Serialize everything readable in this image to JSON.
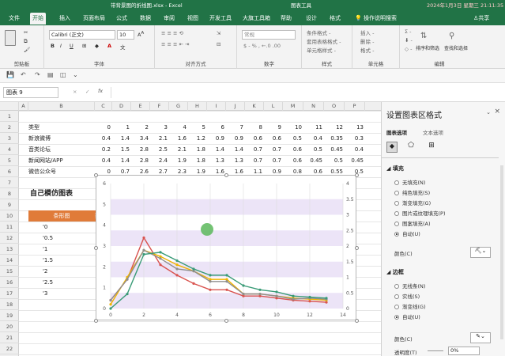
{
  "window": {
    "file_title": "带背景图的折线图.xlsx - Excel",
    "context_tab": "图表工具",
    "date_time": "2024年1月3日 星期三 21:11:35"
  },
  "tabs": [
    {
      "label": "文件"
    },
    {
      "label": "开始"
    },
    {
      "label": "插入"
    },
    {
      "label": "页面布局"
    },
    {
      "label": "公式"
    },
    {
      "label": "数据"
    },
    {
      "label": "审阅"
    },
    {
      "label": "视图"
    },
    {
      "label": "开发工具"
    },
    {
      "label": "大旗工具箱"
    },
    {
      "label": "帮助"
    },
    {
      "label": "设计"
    },
    {
      "label": "格式"
    }
  ],
  "tell_me": "操作说明搜索",
  "share": "共享",
  "ribbon": {
    "clipboard_label": "剪贴板",
    "font_name": "Calibri (正文)",
    "font_size": "10",
    "font_label": "字体",
    "align_label": "对齐方式",
    "number_format": "常规",
    "number_label": "数字",
    "cond_format": "条件格式 -",
    "table_format": "套用表格格式 -",
    "cell_styles": "单元格样式 -",
    "styles_label": "样式",
    "insert": "插入 -",
    "delete": "删除 -",
    "format": "格式 -",
    "cells_label": "单元格",
    "sort_filter": "排序和筛选",
    "find_select": "查找和选择",
    "edit_label": "编辑"
  },
  "formula_bar": {
    "name_box": "图表 9",
    "fx": "fx",
    "cancel": "×",
    "confirm": "✓"
  },
  "columns": [
    "A",
    "B",
    "C",
    "D",
    "E",
    "F",
    "G",
    "H",
    "I",
    "J",
    "K",
    "L",
    "M",
    "N",
    "O",
    "P"
  ],
  "rows": [
    "1",
    "2",
    "3",
    "4",
    "5",
    "6",
    "7",
    "8",
    "9",
    "10",
    "11",
    "12",
    "13",
    "14",
    "15",
    "16",
    "17",
    "18",
    "19",
    "20",
    "21",
    "22"
  ],
  "table": {
    "header_label": "类型",
    "header_values": [
      "0",
      "1",
      "2",
      "3",
      "4",
      "5",
      "6",
      "7",
      "8",
      "9",
      "10",
      "11",
      "12",
      "13"
    ],
    "rows": [
      {
        "label": "新浪微博",
        "values": [
          "0.4",
          "1.4",
          "3.4",
          "2.1",
          "1.6",
          "1.2",
          "0.9",
          "0.9",
          "0.6",
          "0.6",
          "0.5",
          "0.4",
          "0.35",
          "0.3"
        ]
      },
      {
        "label": "音类论坛",
        "values": [
          "0.2",
          "1.5",
          "2.8",
          "2.5",
          "2.1",
          "1.8",
          "1.4",
          "1.4",
          "0.7",
          "0.7",
          "0.6",
          "0.5",
          "0.45",
          "0.4"
        ]
      },
      {
        "label": "新闻网站/APP",
        "values": [
          "0.4",
          "1.4",
          "2.8",
          "2.4",
          "1.9",
          "1.8",
          "1.3",
          "1.3",
          "0.7",
          "0.7",
          "0.6",
          "0.45",
          "0.5",
          "0.45"
        ]
      },
      {
        "label": "微信公众号",
        "values": [
          "0",
          "0.7",
          "2.6",
          "2.7",
          "2.3",
          "1.9",
          "1.6",
          "1.6",
          "1.1",
          "0.9",
          "0.8",
          "0.6",
          "0.55",
          "0.5"
        ]
      }
    ]
  },
  "mock_title": "自己模仿图表",
  "bar_table": {
    "header": "条形图",
    "header2": "数",
    "items": [
      "'0",
      "'0.5",
      "'1",
      "'1.5",
      "'2",
      "'2.5",
      "'3"
    ]
  },
  "chart_data": {
    "type": "line",
    "x": [
      0,
      1,
      2,
      3,
      4,
      5,
      6,
      7,
      8,
      9,
      10,
      11,
      12,
      13
    ],
    "series": [
      {
        "color": "#d9534f",
        "values": [
          0.4,
          1.4,
          3.4,
          2.1,
          1.6,
          1.2,
          0.9,
          0.9,
          0.6,
          0.6,
          0.5,
          0.4,
          0.35,
          0.3
        ]
      },
      {
        "color": "#f0b400",
        "values": [
          0.2,
          1.5,
          2.8,
          2.5,
          2.1,
          1.8,
          1.4,
          1.4,
          0.7,
          0.7,
          0.6,
          0.5,
          0.45,
          0.4
        ]
      },
      {
        "color": "#8e8e8e",
        "values": [
          0.4,
          1.4,
          2.8,
          2.4,
          1.9,
          1.8,
          1.3,
          1.3,
          0.7,
          0.7,
          0.6,
          0.45,
          0.5,
          0.45
        ]
      },
      {
        "color": "#3a9b77",
        "values": [
          0,
          0.7,
          2.6,
          2.7,
          2.3,
          1.9,
          1.6,
          1.6,
          1.1,
          0.9,
          0.8,
          0.6,
          0.55,
          0.5
        ]
      }
    ],
    "xlim": [
      0,
      14
    ],
    "ylim_left": [
      0,
      6
    ],
    "ylim_right": [
      0,
      4
    ],
    "x_ticks": [
      "0",
      "2",
      "4",
      "6",
      "8",
      "10",
      "12",
      "14"
    ],
    "y_left_ticks": [
      "0",
      "1",
      "2",
      "3",
      "4",
      "5",
      "6"
    ],
    "y_right_ticks": [
      "0",
      "0.5",
      "1",
      "1.5",
      "2",
      "2.5",
      "3",
      "3.5",
      "4"
    ],
    "background_bands": "#ece4f7",
    "grid": true
  },
  "panel": {
    "title": "设置图表区格式",
    "tab_chart": "图表选项",
    "tab_text": "文本选项",
    "fill_section": "填充",
    "fill_options": [
      "无填充(N)",
      "纯色填充(S)",
      "渐变填充(G)",
      "图片或纹理填充(P)",
      "图案填充(A)",
      "自动(U)"
    ],
    "color_label": "颜色(C)",
    "border_section": "边框",
    "border_options": [
      "无线条(N)",
      "实线(S)",
      "渐变线(G)",
      "自动(U)"
    ],
    "color_label2": "颜色(C)",
    "transparency_label": "透明度(T)",
    "transparency_value": "0%"
  }
}
